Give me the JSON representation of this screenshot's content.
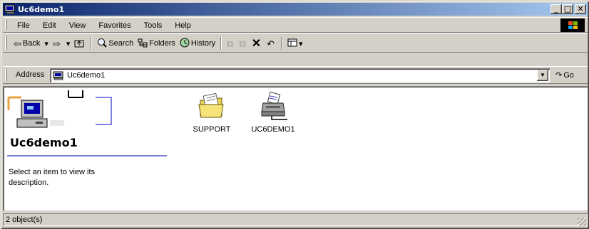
{
  "window": {
    "title": "Uc6demo1"
  },
  "title_controls": {
    "minimize": "_",
    "maximize": "□",
    "close": "✕"
  },
  "menu": [
    "File",
    "Edit",
    "View",
    "Favorites",
    "Tools",
    "Help"
  ],
  "toolbar": {
    "back": "Back",
    "search": "Search",
    "folders": "Folders",
    "history": "History"
  },
  "address": {
    "label": "Address",
    "value": "Uc6demo1",
    "go": "Go"
  },
  "panel": {
    "title": "Uc6demo1",
    "description": "Select an item to view its description."
  },
  "items": [
    {
      "label": "SUPPORT",
      "icon": "folder-icon"
    },
    {
      "label": "UC6DEMO1",
      "icon": "printer-icon"
    }
  ],
  "status": {
    "text": "2 object(s)"
  },
  "colors": {
    "titlebar_start": "#0a246a",
    "titlebar_end": "#a6caf0",
    "face": "#d4d0c8",
    "panel_underline": "#7b7bd3"
  }
}
